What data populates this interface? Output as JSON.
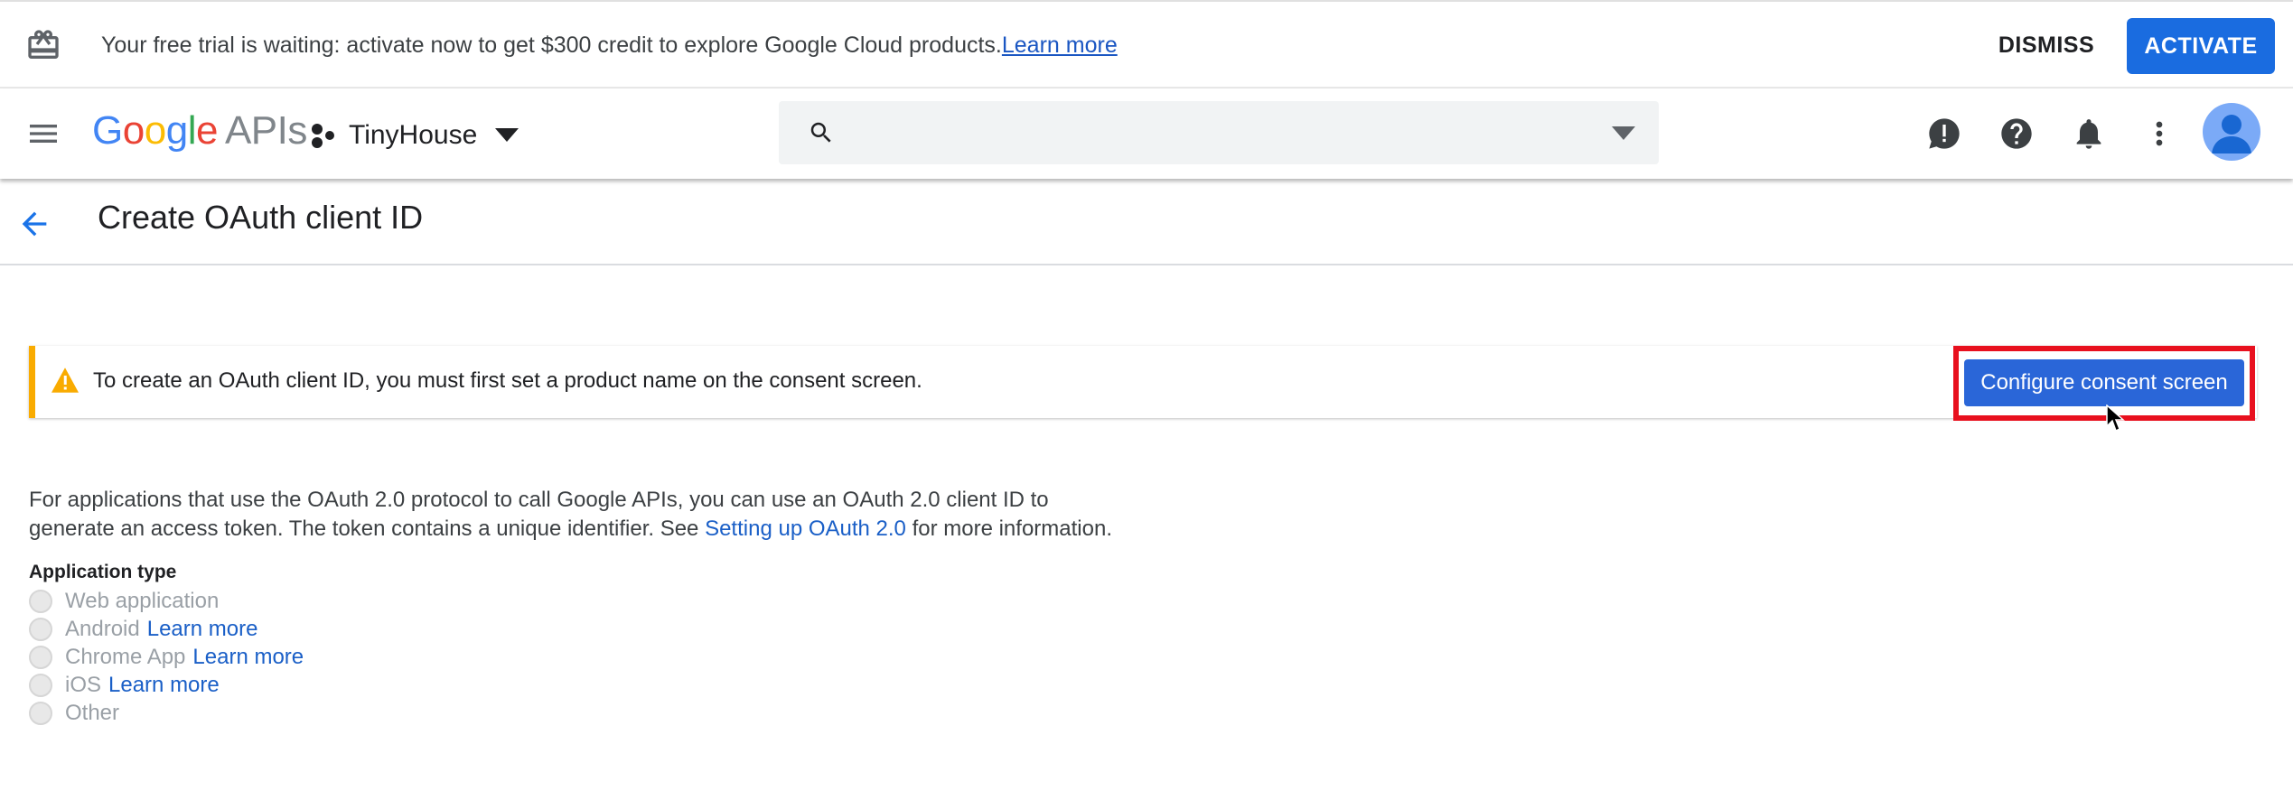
{
  "trial_banner": {
    "message": "Your free trial is waiting: activate now to get $300 credit to explore Google Cloud products.",
    "learn_more": "Learn more",
    "dismiss": "DISMISS",
    "activate": "ACTIVATE",
    "icon": "gift-icon"
  },
  "header": {
    "logo_google": [
      "G",
      "o",
      "o",
      "g",
      "l",
      "e"
    ],
    "logo_apis": "APIs",
    "project_name": "TinyHouse",
    "search_placeholder": "",
    "icons": [
      "menu-icon",
      "search-icon",
      "feedback-icon",
      "help-icon",
      "notifications-icon",
      "more-vert-icon",
      "account-avatar"
    ]
  },
  "page": {
    "title": "Create OAuth client ID"
  },
  "warning": {
    "text": "To create an OAuth client ID, you must first set a product name on the consent screen.",
    "button": "Configure consent screen"
  },
  "description": {
    "line1": "For applications that use the OAuth 2.0 protocol to call Google APIs, you can use an OAuth 2.0 client ID to",
    "line2_prefix": "generate an access token. The token contains a unique identifier. See ",
    "link": "Setting up OAuth 2.0",
    "line2_suffix": " for more information."
  },
  "application_type": {
    "label": "Application type",
    "options": [
      {
        "label": "Web application",
        "link": ""
      },
      {
        "label": "Android",
        "link": "Learn more"
      },
      {
        "label": "Chrome App",
        "link": "Learn more"
      },
      {
        "label": "iOS",
        "link": "Learn more"
      },
      {
        "label": "Other",
        "link": ""
      }
    ]
  },
  "colors": {
    "accent": "#1a6ce0",
    "warning": "#f9ab00",
    "highlight": "#e8101e"
  }
}
